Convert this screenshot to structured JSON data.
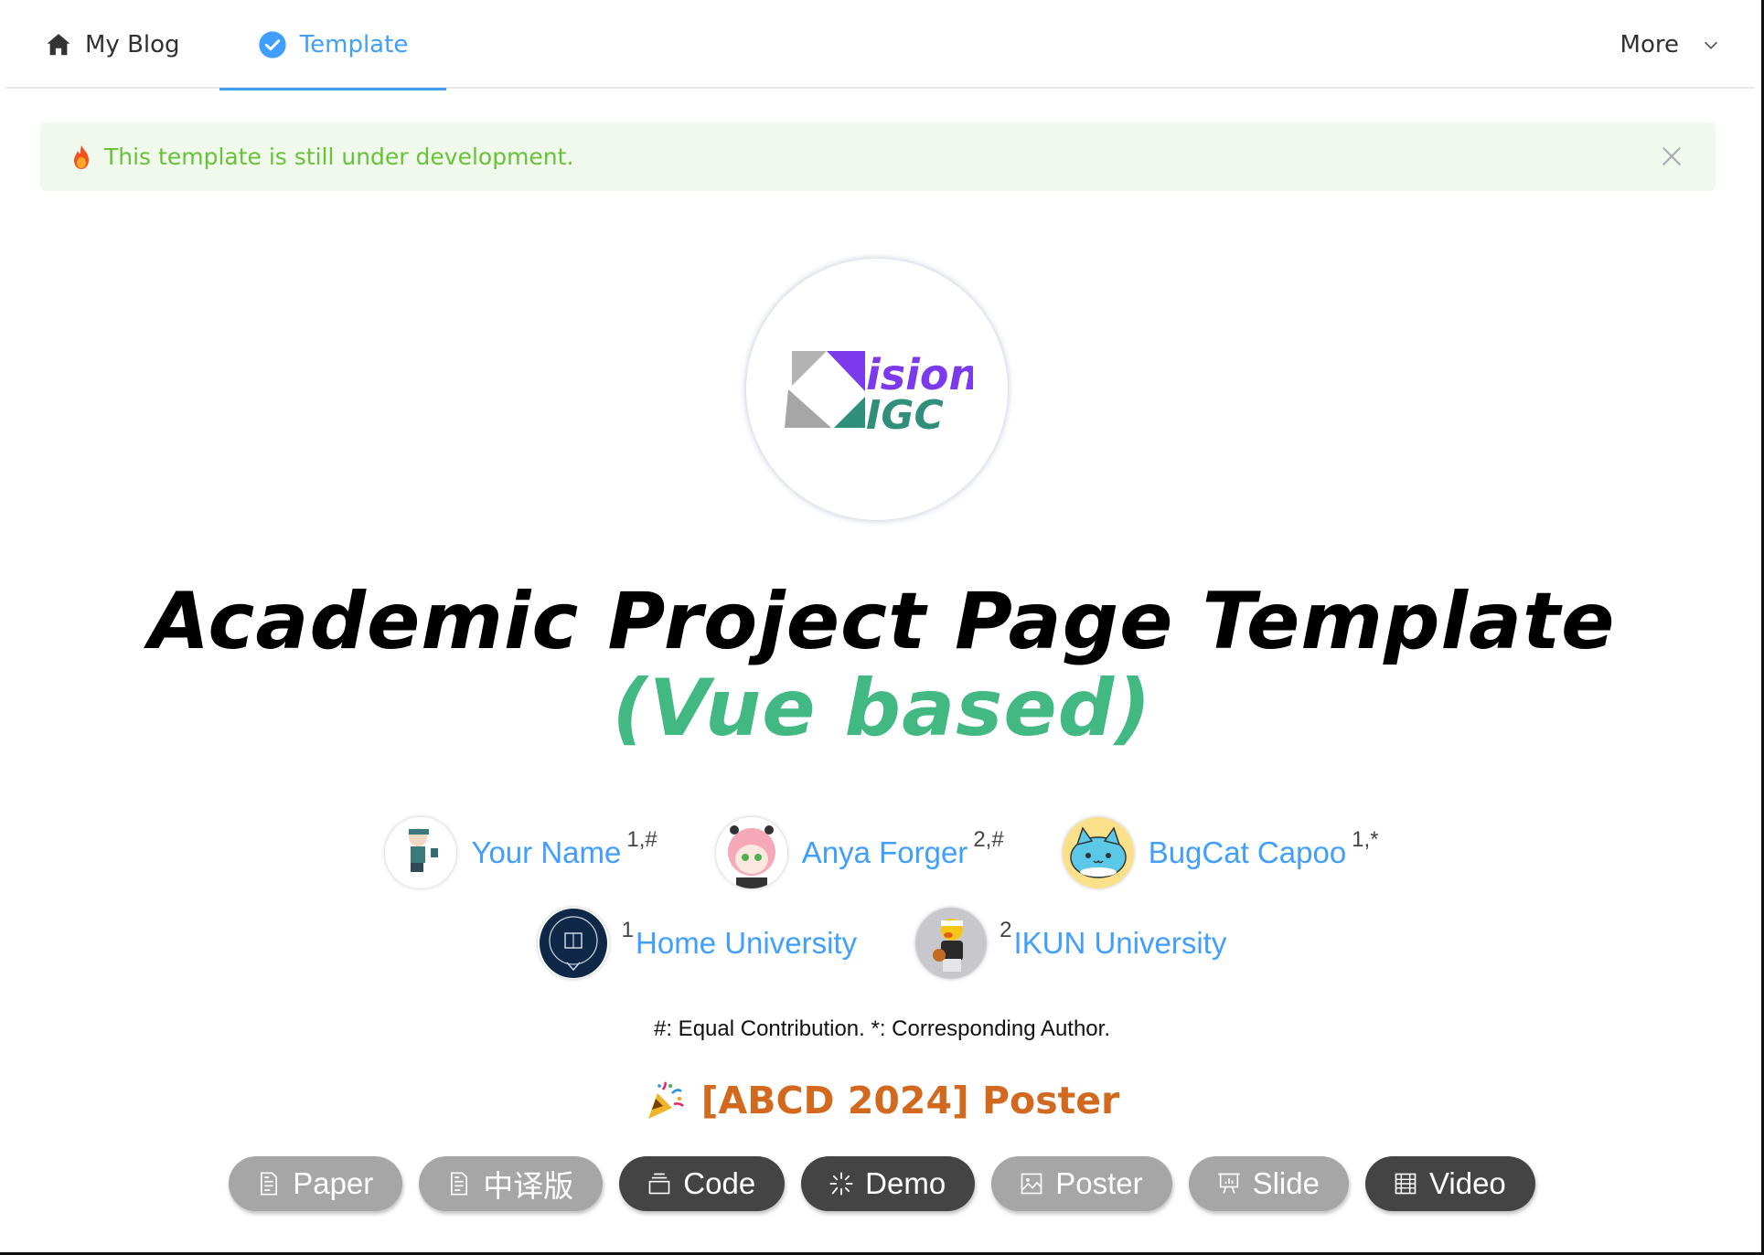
{
  "header": {
    "tabs": [
      {
        "label": "My Blog",
        "icon": "home-icon",
        "active": false
      },
      {
        "label": "Template",
        "icon": "check-circle-icon",
        "active": true
      }
    ],
    "more_label": "More",
    "accent_color": "#409eff"
  },
  "alert": {
    "icon": "fire-icon",
    "message": "This template is still under development.",
    "type": "success"
  },
  "logo": {
    "text_top": "ision",
    "text_bottom": "IGC",
    "alt": "VisionAIGC logo"
  },
  "title": {
    "line1": "Academic Project Page Template",
    "line2": "(Vue based)",
    "line2_color": "#42b883"
  },
  "authors": [
    {
      "name": "Your Name",
      "sup": "1,#"
    },
    {
      "name": "Anya Forger",
      "sup": "2,#"
    },
    {
      "name": "BugCat Capoo",
      "sup": "1,*"
    }
  ],
  "affiliations": [
    {
      "index": "1",
      "name": "Home University"
    },
    {
      "index": "2",
      "name": "IKUN University"
    }
  ],
  "note": "#: Equal Contribution. *: Corresponding Author.",
  "venue": {
    "icon": "party-popper-icon",
    "text": "[ABCD 2024] Poster"
  },
  "buttons": [
    {
      "label": "Paper",
      "icon": "document-icon",
      "enabled": false
    },
    {
      "label": "中译版",
      "icon": "document-icon",
      "enabled": false
    },
    {
      "label": "Code",
      "icon": "box-icon",
      "enabled": true
    },
    {
      "label": "Demo",
      "icon": "loading-sparkle-icon",
      "enabled": true
    },
    {
      "label": "Poster",
      "icon": "picture-icon",
      "enabled": false
    },
    {
      "label": "Slide",
      "icon": "presentation-icon",
      "enabled": false
    },
    {
      "label": "Video",
      "icon": "film-icon",
      "enabled": true
    }
  ]
}
